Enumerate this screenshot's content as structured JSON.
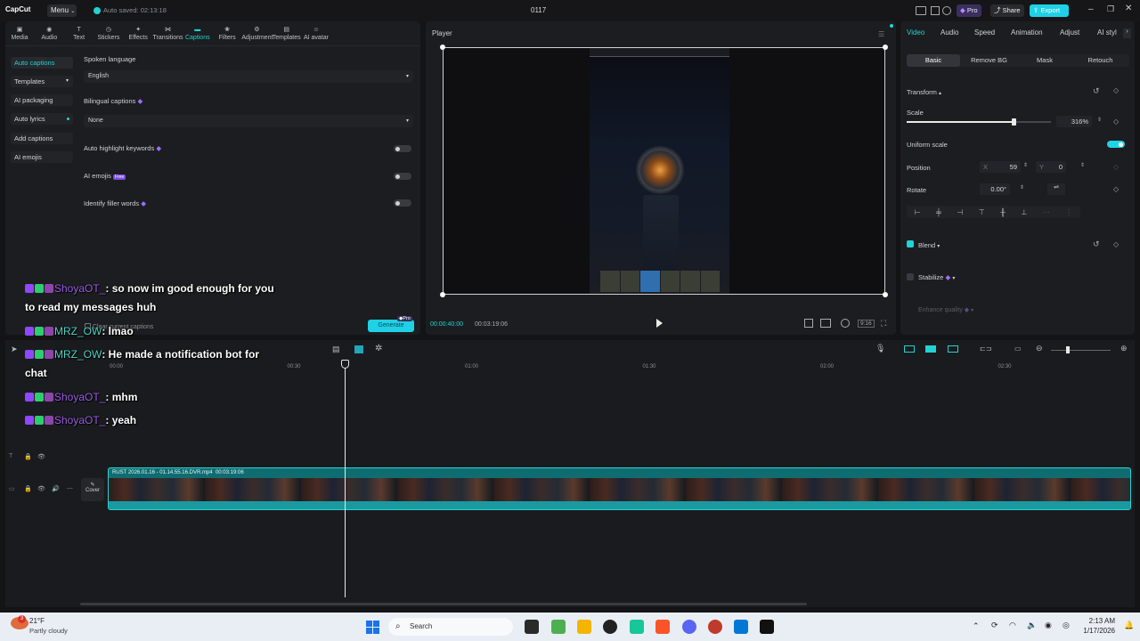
{
  "titlebar": {
    "logo": "CapCut",
    "menu_label": "Menu",
    "autosave": "Auto saved: 02:13:18",
    "project_name": "0117",
    "pro_label": "Pro",
    "share_label": "Share",
    "export_label": "Export"
  },
  "toolbar": {
    "items": [
      "Media",
      "Audio",
      "Text",
      "Stickers",
      "Effects",
      "Transitions",
      "Captions",
      "Filters",
      "Adjustment",
      "Templates",
      "AI avatar"
    ],
    "active": "Captions"
  },
  "captions_sidebar": {
    "items": [
      "Auto captions",
      "Templates",
      "AI packaging",
      "Auto lyrics",
      "Add captions",
      "AI emojis"
    ]
  },
  "captions_panel": {
    "spoken_language_label": "Spoken language",
    "spoken_language_value": "English",
    "bilingual_label": "Bilingual captions",
    "bilingual_value": "None",
    "auto_highlight_label": "Auto highlight keywords",
    "ai_emojis_label": "AI emojis",
    "ai_emojis_badge": "Free",
    "filler_words_label": "Identify filler words",
    "clear_label": "Clear current captions",
    "generate_label": "Generate",
    "generate_badge": "Pro"
  },
  "player": {
    "title": "Player",
    "current_time": "00:00:40:00",
    "total_time": "00:03:19:06",
    "ratio_label": "9:16"
  },
  "right_panel": {
    "tabs": [
      "Video",
      "Audio",
      "Speed",
      "Animation",
      "Adjust",
      "AI styl"
    ],
    "subtabs": [
      "Basic",
      "Remove BG",
      "Mask",
      "Retouch"
    ],
    "transform_label": "Transform",
    "scale_label": "Scale",
    "scale_value": "316%",
    "scale_fraction": 0.74,
    "uniform_scale_label": "Uniform scale",
    "uniform_scale_on": true,
    "position_label": "Position",
    "pos_x_label": "X",
    "pos_x_value": "59",
    "pos_y_label": "Y",
    "pos_y_value": "0",
    "rotate_label": "Rotate",
    "rotate_value": "0.00°",
    "blend_label": "Blend",
    "stabilize_label": "Stabilize",
    "enhance_label": "Enhance quality"
  },
  "chat": {
    "lines": [
      {
        "user": "ShoyaOT_",
        "text": ": so now im good enough for you",
        "cont": "to read my messages huh",
        "color": "purple"
      },
      {
        "user": "MRZ_OW",
        "text": ": lmao",
        "color": "teal"
      },
      {
        "user": "MRZ_OW",
        "text": ": He made a notification bot for",
        "cont": "chat",
        "color": "teal"
      },
      {
        "user": "ShoyaOT_",
        "text": ": mhm",
        "color": "purple"
      },
      {
        "user": "ShoyaOT_",
        "text": ": yeah",
        "color": "purple"
      }
    ]
  },
  "timeline": {
    "ticks": [
      "00:00",
      "00:30",
      "01:00",
      "01:30",
      "02:00",
      "02:30"
    ],
    "clip_name": "RUST 2026.01.16 - 01.14.55.16.DVR.mp4",
    "clip_duration": "00:03:19:06",
    "cover_label": "Cover"
  },
  "taskbar": {
    "temperature": "21°F",
    "weather": "Partly cloudy",
    "notification_count": "3",
    "search_label": "Search",
    "time": "2:13 AM",
    "date": "1/17/2026"
  },
  "colors": {
    "accent": "#22d3d3",
    "export": "#1fd1e6",
    "purple_user": "#9b5de5",
    "teal_user": "#4fd1c5"
  }
}
